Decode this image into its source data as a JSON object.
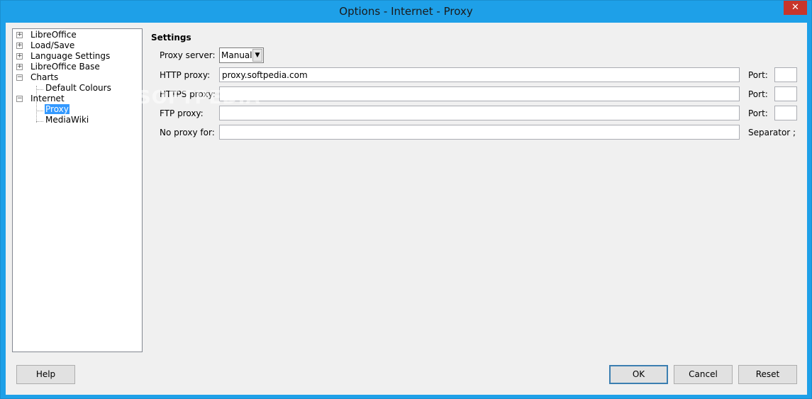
{
  "window": {
    "title": "Options - Internet - Proxy",
    "close_glyph": "✕"
  },
  "tree": {
    "items": [
      {
        "label": "LibreOffice",
        "expander": "+"
      },
      {
        "label": "Load/Save",
        "expander": "+"
      },
      {
        "label": "Language Settings",
        "expander": "+"
      },
      {
        "label": "LibreOffice Base",
        "expander": "+"
      },
      {
        "label": "Charts",
        "expander": "−"
      },
      {
        "label": "Default Colours"
      },
      {
        "label": "Internet",
        "expander": "−"
      },
      {
        "label": "Proxy",
        "selected": true
      },
      {
        "label": "MediaWiki"
      }
    ]
  },
  "settings": {
    "title": "Settings",
    "proxy_server_label": "Proxy server:",
    "proxy_server_value": "Manual",
    "http_label": "HTTP proxy:",
    "http_value": "proxy.softpedia.com",
    "https_label": "HTTPS proxy:",
    "https_value": "",
    "ftp_label": "FTP proxy:",
    "ftp_value": "",
    "noproxy_label": "No proxy for:",
    "noproxy_value": "",
    "port_label": "Port:",
    "separator_label": "Separator ;"
  },
  "watermark": "SOFTPEDIA",
  "buttons": {
    "help": "Help",
    "ok": "OK",
    "cancel": "Cancel",
    "reset": "Reset"
  }
}
